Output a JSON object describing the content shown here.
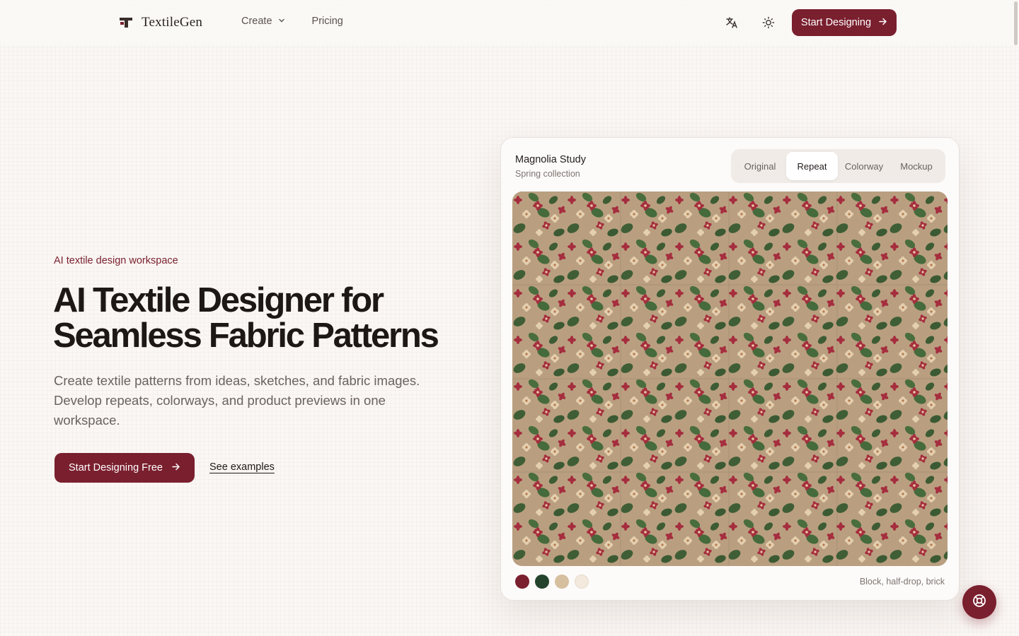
{
  "brand": {
    "name": "TextileGen",
    "accent": "#7a1f2e"
  },
  "nav": {
    "create_label": "Create",
    "pricing_label": "Pricing",
    "cta_label": "Start Designing"
  },
  "hero": {
    "eyebrow": "AI textile design workspace",
    "headline_line1": "AI Textile Designer for",
    "headline_line2": "Seamless Fabric Patterns",
    "subtitle": "Create textile patterns from ideas, sketches, and fabric images. Develop repeats, colorways, and product previews in one workspace.",
    "primary_cta": "Start Designing Free",
    "secondary_cta": "See examples"
  },
  "preview": {
    "title": "Magnolia Study",
    "subtitle": "Spring collection",
    "tabs": [
      {
        "label": "Original",
        "active": false
      },
      {
        "label": "Repeat",
        "active": true
      },
      {
        "label": "Colorway",
        "active": false
      },
      {
        "label": "Mockup",
        "active": false
      }
    ],
    "swatches": [
      "#7a1f2e",
      "#24432c",
      "#d6bf9e",
      "#f3e9dc"
    ],
    "repeat_types": "Block, half-drop, brick"
  },
  "icons": {
    "translate": "translate-icon",
    "theme": "sun-icon",
    "help": "lifebuoy-icon"
  }
}
